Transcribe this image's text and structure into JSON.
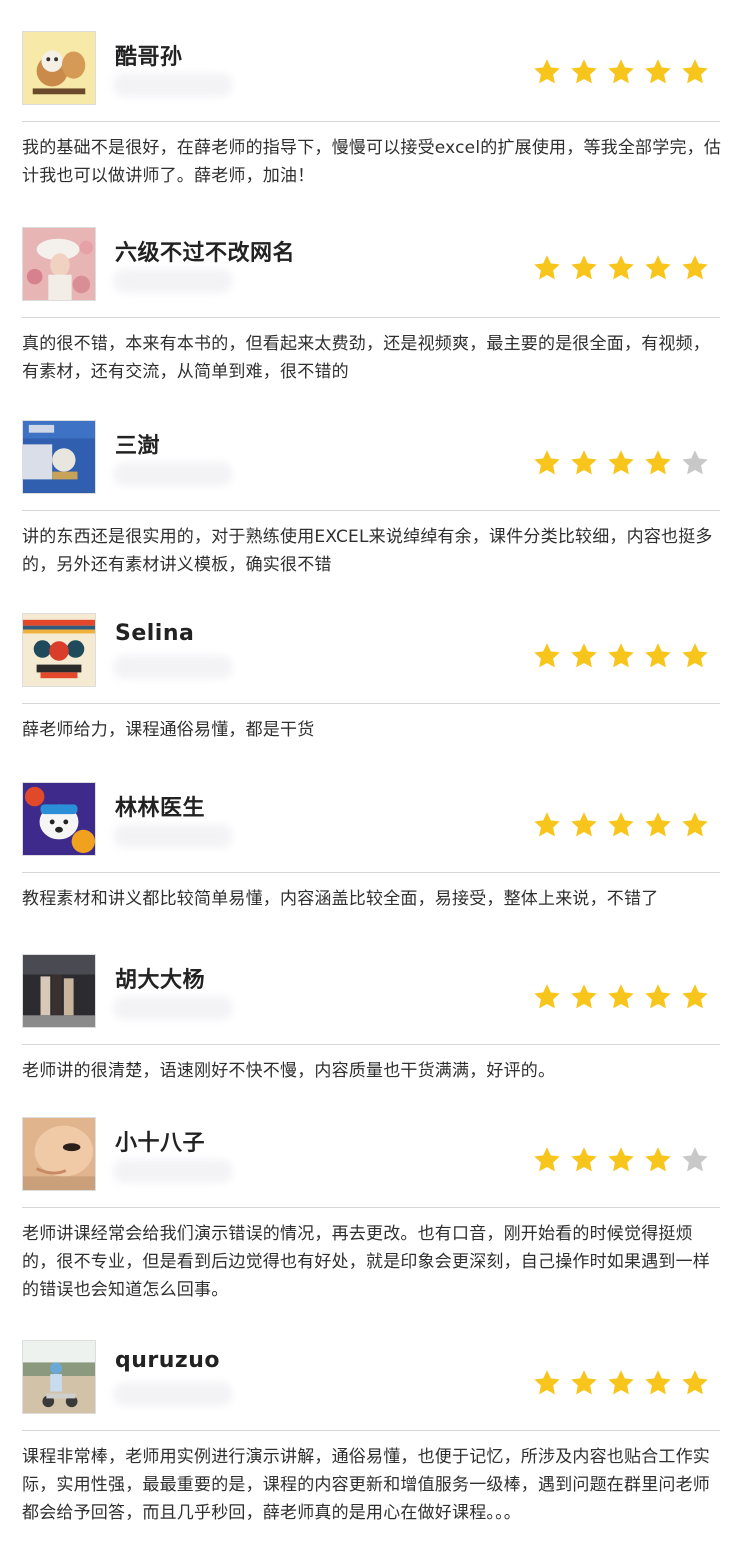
{
  "colors": {
    "star_filled": "#F8C51C",
    "star_empty": "#C8C8C8",
    "divider": "#D6D6D6"
  },
  "reviews": [
    {
      "user": "酷哥孙",
      "rating": 5,
      "avatar": "cartoon-bear-avatar",
      "text": "我的基础不是很好，在薛老师的指导下，慢慢可以接受excel的扩展使用，等我全部学完，估计我也可以做讲师了。薛老师，加油！"
    },
    {
      "user": "六级不过不改网名",
      "rating": 5,
      "avatar": "girl-with-hat-avatar",
      "text": "真的很不错，本来有本书的，但看起来太费劲，还是视频爽，最主要的是很全面，有视频，有素材，还有交流，从简单到难，很不错的"
    },
    {
      "user": "三澍",
      "rating": 4,
      "avatar": "blue-poster-avatar",
      "text": "讲的东西还是很实用的，对于熟练使用EXCEL来说绰绰有余，课件分类比较细，内容也挺多的，另外还有素材讲义模板，确实很不错"
    },
    {
      "user": "Selina",
      "rating": 5,
      "avatar": "pattern-avatar",
      "text": "薛老师给力，课程通俗易懂，都是干货"
    },
    {
      "user": "林林医生",
      "rating": 5,
      "avatar": "polar-bear-avatar",
      "text": "教程素材和讲义都比较简单易懂，内容涵盖比较全面，易接受，整体上来说，不错了"
    },
    {
      "user": "胡大大杨",
      "rating": 5,
      "avatar": "group-photo-avatar",
      "text": "老师讲的很清楚，语速刚好不快不慢，内容质量也干货满满，好评的。"
    },
    {
      "user": "小十八子",
      "rating": 4,
      "avatar": "face-closeup-avatar",
      "text": "老师讲课经常会给我们演示错误的情况，再去更改。也有口音，刚开始看的时候觉得挺烦的，很不专业，但是看到后边觉得也有好处，就是印象会更深刻，自己操作时如果遇到一样的错误也会知道怎么回事。"
    },
    {
      "user": "quruzuo",
      "rating": 5,
      "avatar": "child-scooter-avatar",
      "text": "课程非常棒，老师用实例进行演示讲解，通俗易懂，也便于记忆，所涉及内容也贴合工作实际，实用性强，最最重要的是，课程的内容更新和增值服务一级棒，遇到问题在群里问老师都会给予回答，而且几乎秒回，薛老师真的是用心在做好课程。。。"
    }
  ]
}
